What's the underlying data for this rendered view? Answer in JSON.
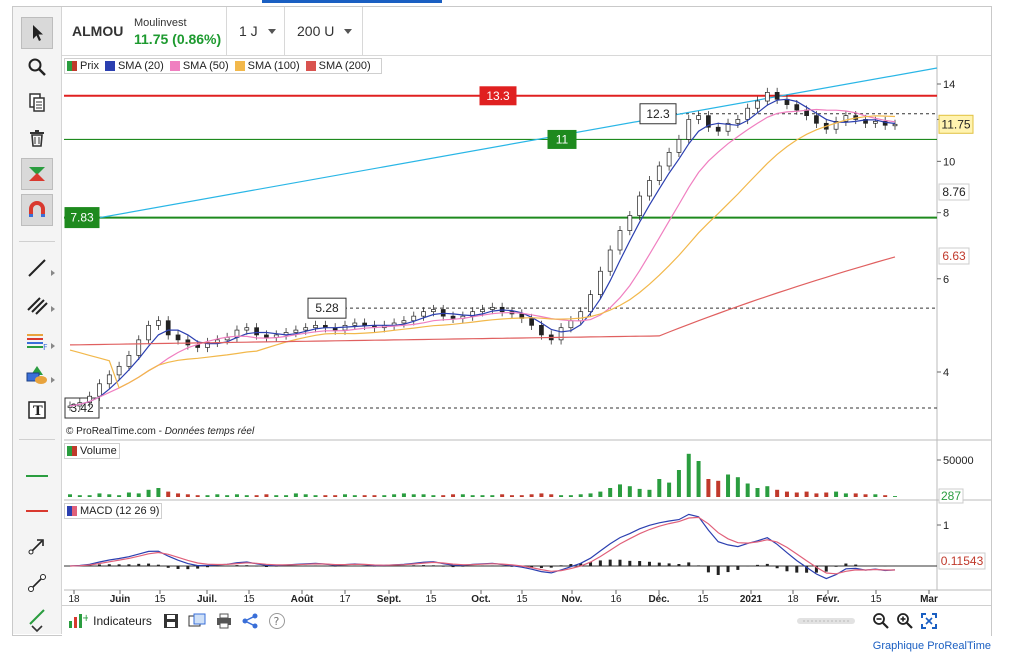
{
  "header": {
    "symbol": "ALMOU",
    "company": "Moulinvest",
    "price_change": "11.75 (0.86%)",
    "period": "1 J",
    "units": "200 U"
  },
  "legend_price": {
    "items": [
      {
        "label": "Prix",
        "color": "#2a9d3f"
      },
      {
        "label": "SMA (20)",
        "color": "#2b3fb0"
      },
      {
        "label": "SMA (50)",
        "color": "#f07fc0"
      },
      {
        "label": "SMA (100)",
        "color": "#f2b84b"
      },
      {
        "label": "SMA (200)",
        "color": "#d9534f"
      }
    ]
  },
  "legend_volume": {
    "label": "Volume"
  },
  "legend_macd": {
    "label": "MACD (12 26 9)"
  },
  "credit": {
    "site": "© ProRealTime.com",
    "note": "Données temps réel"
  },
  "price_axis": {
    "ticks": [
      "14",
      "12",
      "10",
      "8",
      "6",
      "4"
    ]
  },
  "price_tags": {
    "last": "11.75",
    "sma100": "8.76",
    "sma200": "6.63"
  },
  "levels": {
    "resistance": "13.3",
    "high_box": "12.3",
    "support": "11",
    "low_support": "7.83",
    "box_528": "5.28",
    "box_342": "3.42"
  },
  "volume_axis": {
    "tick": "50000",
    "last": "287"
  },
  "macd_axis": {
    "tick": "1",
    "last": "0.11543"
  },
  "time_axis": {
    "labels": [
      "18",
      "Juin",
      "15",
      "Juil.",
      "15",
      "Août",
      "17",
      "Sept.",
      "15",
      "Oct.",
      "15",
      "Nov.",
      "16",
      "Déc.",
      "15",
      "2021",
      "18",
      "Févr.",
      "15",
      "Mar"
    ]
  },
  "bottom": {
    "indicators": "Indicateurs"
  },
  "footer": {
    "text": "Graphique ProRealTime"
  },
  "colors": {
    "up": "#2a9d3f",
    "down": "#c0392b",
    "trendline": "#29b6e6",
    "resistance": "#e02020",
    "support": "#1e8a1e",
    "macd": "#2b3fb0",
    "signal": "#e0607a"
  },
  "icons": {
    "toolbar": [
      "cursor-icon",
      "zoom-icon",
      "copy-icon",
      "trash-icon",
      "magnet-alert-icon",
      "magnet-icon",
      "line-icon",
      "parallel-lines-icon",
      "fibonacci-icon",
      "shapes-icon",
      "text-icon",
      "horizontal-line-green-icon",
      "horizontal-line-red-icon",
      "arrow-icon",
      "segment-icon",
      "trend-icon"
    ]
  }
}
